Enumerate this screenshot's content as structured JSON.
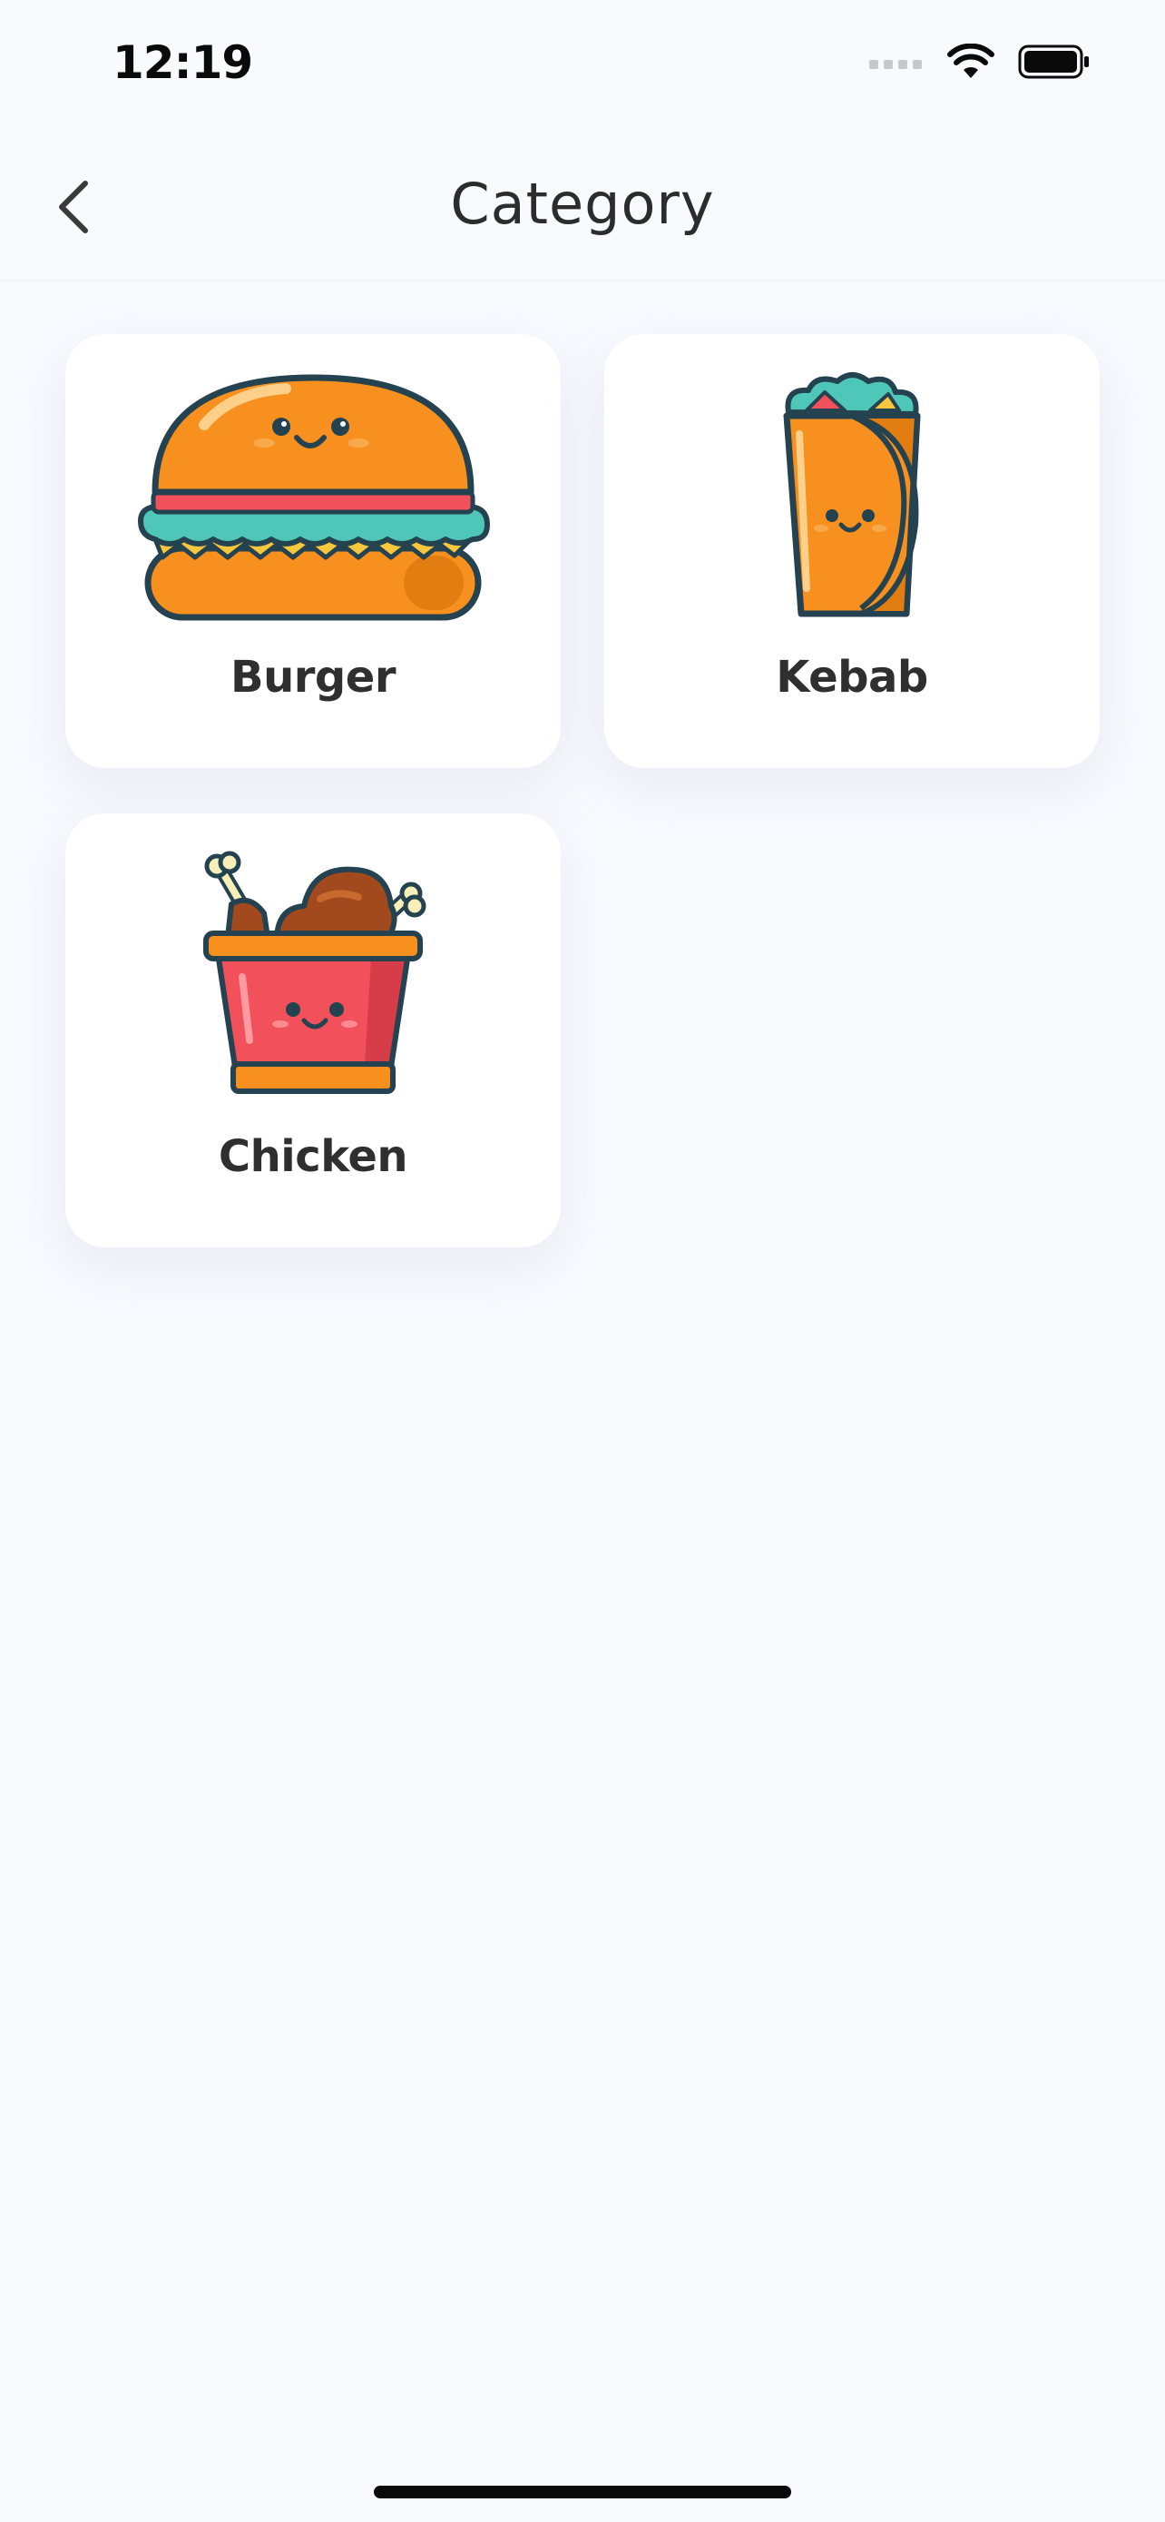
{
  "status_bar": {
    "time": "12:19",
    "icons": [
      "cellular-signal-icon",
      "wifi-icon",
      "battery-icon"
    ]
  },
  "header": {
    "back_icon": "chevron-left-icon",
    "title": "Category"
  },
  "categories": [
    {
      "label": "Burger",
      "icon": "burger-icon"
    },
    {
      "label": "Kebab",
      "icon": "kebab-icon"
    },
    {
      "label": "Chicken",
      "icon": "chicken-bucket-icon"
    }
  ],
  "colors": {
    "background": "#f9fafe",
    "card": "#ffffff",
    "text": "#2f2f2f",
    "orange": "#f7901e",
    "teal": "#4fc7b8",
    "red": "#f2505a",
    "outline": "#24424f"
  }
}
